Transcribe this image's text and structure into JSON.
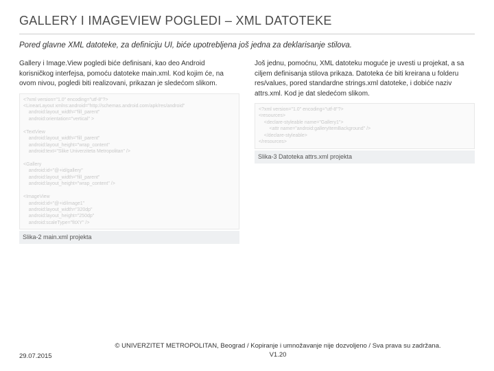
{
  "title": "GALLERY I IMAGEVIEW POGLEDI – XML DATOTEKE",
  "subtitle": "Pored glavne XML datoteke, za definiciju UI, biće upotrebljena još jedna za deklarisanje stilova.",
  "left": {
    "para": "Gallery i Image.View pogledi biće definisani, kao deo Android korisničkog interfejsa, pomoću datoteke main.xml. Kod kojim će, na ovom nivou, pogledi biti realizovani, prikazan je sledećom slikom.",
    "code": "<?xml version=\"1.0\" encoding=\"utf-8\"?>\n<LinearLayout xmlns:android=\"http://schemas.android.com/apk/res/android\"\n    android:layout_width=\"fill_parent\"\n    android:orientation=\"vertical\" >\n\n<TextView\n    android:layout_width=\"fill_parent\"\n    android:layout_height=\"wrap_content\"\n    android:text=\"Slike Univerziteta Metropolitan\" />\n\n<Gallery\n    android:id=\"@+id/gallery\"\n    android:layout_width=\"fill_parent\"\n    android:layout_height=\"wrap_content\" />\n\n<ImageView\n    android:id=\"@+id/image1\"\n    android:layout_width=\"320dp\"\n    android:layout_height=\"250dp\"\n    android:scaleType=\"fitXY\" />",
    "caption": "Slika-2 main.xml projekta"
  },
  "right": {
    "para": "Još jednu, pomoćnu, XML datoteku moguće je uvesti u projekat, a sa ciljem definisanja stilova prikaza. Datoteka će biti kreirana u folderu res/values, pored standardne strings.xml datoteke, i dobiće naziv attrs.xml. Kod je dat sledećom slikom.",
    "code": "<?xml version=\"1.0\" encoding=\"utf-8\"?>\n<resources>\n    <declare-styleable name=\"Gallery1\">\n        <attr name=\"android:galleryItemBackground\" />\n    </declare-styleable>\n</resources>",
    "caption": "Slika-3 Datoteka attrs.xml projekta"
  },
  "footer": {
    "date": "29.07.2015",
    "copyright": "© UNIVERZITET METROPOLITAN, Beograd / Kopiranje i umnožavanje nije dozvoljeno / Sva prava su zadržana.",
    "version": "V1.20"
  }
}
